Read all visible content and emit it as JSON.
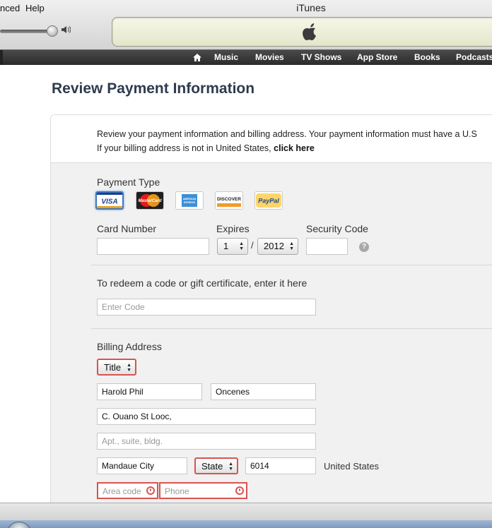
{
  "window": {
    "title": "iTunes",
    "menu": [
      "nced",
      "Help"
    ]
  },
  "nav": {
    "items": [
      "Music",
      "Movies",
      "TV Shows",
      "App Store",
      "Books",
      "Podcasts"
    ]
  },
  "page": {
    "title": "Review Payment Information",
    "intro_line1": "Review your payment information and billing address. Your payment information must have a U.S",
    "intro_line2_prefix": "If your billing address is not in United States, ",
    "intro_click_here": "click here"
  },
  "payment": {
    "type_label": "Payment Type",
    "cards": [
      {
        "name": "VISA",
        "selected": true
      },
      {
        "name": "MasterCard",
        "selected": false
      },
      {
        "name": "AMERICAN EXPRESS",
        "selected": false
      },
      {
        "name": "DISCOVER",
        "selected": false
      },
      {
        "name": "PayPal",
        "selected": false
      }
    ],
    "card_number_label": "Card Number",
    "card_number_value": "",
    "expires_label": "Expires",
    "expires_month": "1",
    "expires_separator": "/",
    "expires_year": "2012",
    "security_code_label": "Security Code",
    "security_code_value": "",
    "help_symbol": "?"
  },
  "redeem": {
    "label": "To redeem a code or gift certificate, enter it here",
    "placeholder": "Enter Code"
  },
  "billing": {
    "label": "Billing Address",
    "title_select": "Title",
    "first_name": "Harold Phil",
    "last_name": "Oncenes",
    "street": "C. Ouano St Looc,",
    "apt_placeholder": "Apt., suite, bldg.",
    "city": "Mandaue City",
    "state_select": "State",
    "zip": "6014",
    "country": "United States",
    "area_code_placeholder": "Area code",
    "phone_placeholder": "Phone"
  },
  "colors": {
    "error": "#d9534f",
    "selected_card_border": "#3f78c2",
    "title": "#2e3b4e"
  }
}
